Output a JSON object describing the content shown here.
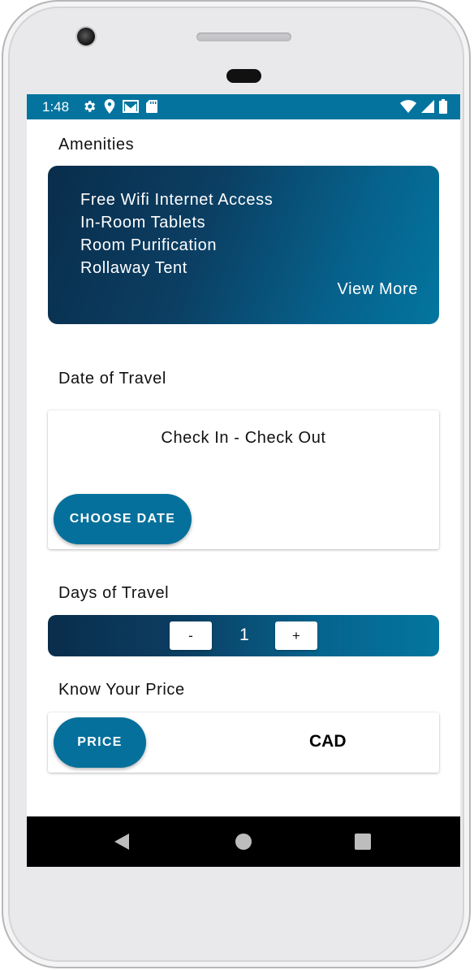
{
  "status_bar": {
    "time": "1:48",
    "left_icons": [
      "gear-icon",
      "location-pin-icon",
      "gmail-icon",
      "sd-card-icon"
    ],
    "right_icons": [
      "wifi-icon",
      "cell-signal-icon",
      "battery-icon"
    ],
    "background_color": "#04749f"
  },
  "amenities": {
    "section_title": "Amenities",
    "items": [
      "Free Wifi Internet Access",
      "In-Room Tablets",
      "Room Purification",
      "Rollaway Tent"
    ],
    "view_more_label": "View More"
  },
  "date_of_travel": {
    "section_title": "Date of Travel",
    "range_text": "Check In - Check Out",
    "choose_date_label": "CHOOSE DATE"
  },
  "days_of_travel": {
    "section_title": "Days of Travel",
    "minus_label": "-",
    "value": "1",
    "plus_label": "+"
  },
  "price": {
    "section_title": "Know Your Price",
    "price_button_label": "PRICE",
    "currency": "CAD"
  },
  "nav_bar": {
    "icons": [
      "back-icon",
      "home-icon",
      "recents-icon"
    ]
  },
  "colors": {
    "primary": "#05709b",
    "gradient_dark": "#0a2d4b",
    "gradient_light": "#03769f"
  }
}
